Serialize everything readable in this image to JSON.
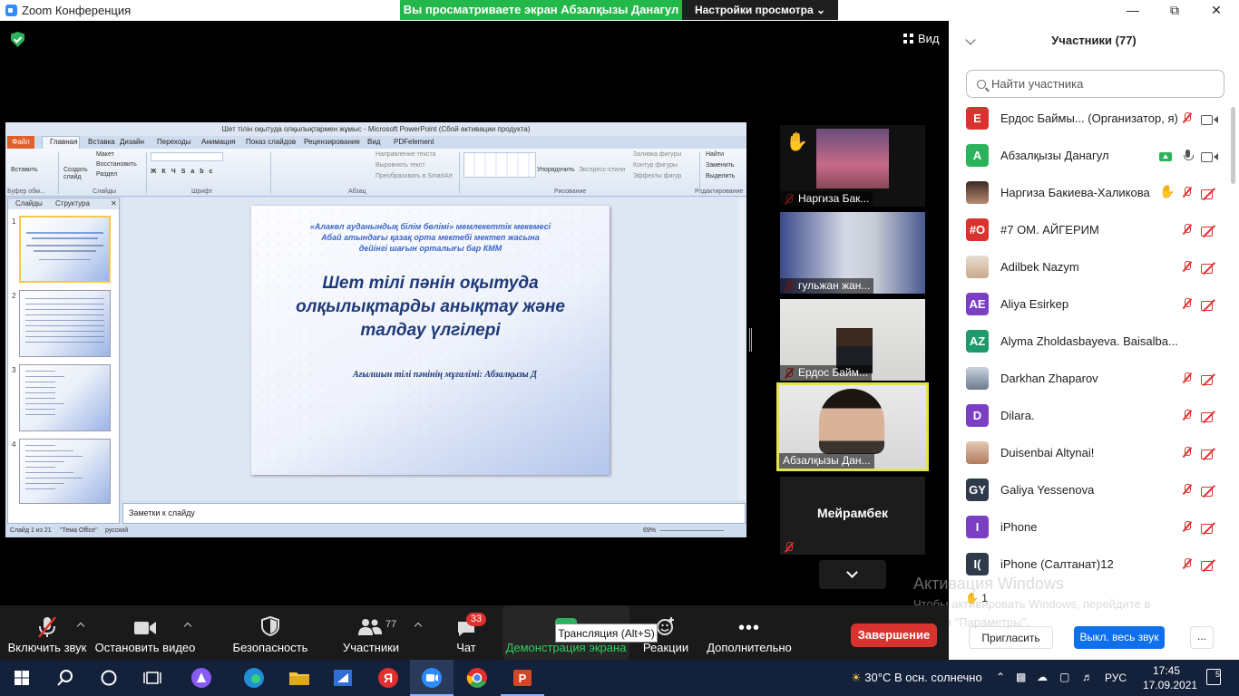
{
  "titlebar": {
    "app_title": "Zoom Конференция",
    "share_banner": "Вы просматриваете экран Абзалқызы Данагул",
    "view_options": "Настройки просмотра"
  },
  "meeting": {
    "view_label": "Вид"
  },
  "ppt": {
    "window_title": "Шет тілін оқытуда олқылықтармен жұмыс - Microsoft PowerPoint (Сбой активации продукта)",
    "file_tab": "Файл",
    "tabs": [
      "Главная",
      "Вставка",
      "Дизайн",
      "Переходы",
      "Анимация",
      "Показ слайдов",
      "Рецензирование",
      "Вид",
      "PDFelement"
    ],
    "ribbon": {
      "paste": "Вставить",
      "new_slide": "Создать слайд",
      "layout": "Макет",
      "reset": "Восстановить",
      "section": "Раздел",
      "text_direction": "Направление текста",
      "align_text": "Выровнять текст",
      "smartart": "Преобразовать в SmartArt",
      "arrange": "Упорядочить",
      "quick_styles": "Экспресс-стили",
      "shape_fill": "Заливка фигуры",
      "shape_outline": "Контур фигуры",
      "shape_effects": "Эффекты фигур",
      "find": "Найти",
      "replace": "Заменить",
      "select": "Выделить",
      "group_clipboard": "Буфер обм...",
      "group_slides": "Слайды",
      "group_font": "Шрифт",
      "group_paragraph": "Абзац",
      "group_drawing": "Рисование",
      "group_editing": "Редактирование"
    },
    "panel_tabs": [
      "Слайды",
      "Структура"
    ],
    "thumb_numbers": [
      "1",
      "2",
      "3",
      "4"
    ],
    "slide": {
      "org_line1": "«Алакөл ауданындық білім бөлімі» мемлекеттік мекемесі",
      "org_line2": "Абай атындағы қазақ орта мектебі мектеп жасына",
      "org_line3": "дейінгі шағын орталығы бар КММ",
      "title_line1": "Шет тілі пәнін оқытуда",
      "title_line2": "олқылықтарды анықтау және",
      "title_line3": "талдау үлгілері",
      "author": "Ағылшын тілі пәнінің мұғалімі: Абзалқызы Д"
    },
    "notes": "Заметки к слайду",
    "status": {
      "slide_count": "Слайд 1 из 21",
      "theme": "\"Тема Office\"",
      "language": "русский",
      "zoom": "69%"
    }
  },
  "gallery": [
    {
      "name": "Наргиза Бак...",
      "muted": true
    },
    {
      "name": "гульжан жан...",
      "muted": true
    },
    {
      "name": "Ердос Байм...",
      "muted": true
    },
    {
      "name": "Абзалқызы Дан...",
      "muted": false
    },
    {
      "name": "Мейрамбек",
      "muted": true
    }
  ],
  "participants": {
    "title": "Участники (77)",
    "search_placeholder": "Найти участника",
    "list": [
      {
        "initials": "E",
        "name": "Ердос Баймы... (Организатор, я)",
        "color": "#d9332f"
      },
      {
        "initials": "A",
        "name": "Абзалқызы Данагул",
        "color": "#2bb35b"
      },
      {
        "initials": "",
        "name": "Наргиза Бакиева-Халикова",
        "color": "#6b4a3a"
      },
      {
        "initials": "#O",
        "name": "#7 ОМ. АЙГЕРИМ",
        "color": "#d9332f"
      },
      {
        "initials": "",
        "name": "Adilbek Nazym",
        "color": "#c8b6a0"
      },
      {
        "initials": "AE",
        "name": "Aliya Esirkep",
        "color": "#7b3fc4"
      },
      {
        "initials": "AZ",
        "name": "Alyma Zholdasbayeva. Baisalba...",
        "color": "#1f9a6a"
      },
      {
        "initials": "",
        "name": "Darkhan Zhaparov",
        "color": "#7f8fa5"
      },
      {
        "initials": "D",
        "name": "Dilara.",
        "color": "#7b3fc4"
      },
      {
        "initials": "",
        "name": "Duisenbai Altynai!",
        "color": "#c8a08a"
      },
      {
        "initials": "GY",
        "name": "Galiya Yessenova",
        "color": "#2f3a4a"
      },
      {
        "initials": "I",
        "name": "iPhone",
        "color": "#7b3fc4"
      },
      {
        "initials": "I(",
        "name": "iPhone (Салтанат)12",
        "color": "#2f3a4a"
      }
    ],
    "raised_count": "1",
    "invite": "Пригласить",
    "mute_all": "Выкл. весь звук",
    "more": "..."
  },
  "activation": {
    "title": "Активация Windows",
    "line1": "Чтобы активировать Windows, перейдите в",
    "line2": "раздел \"Параметры\"."
  },
  "toolbar": {
    "unmute": "Включить звук",
    "start_video": "Остановить видео",
    "security": "Безопасность",
    "participants": "Участники",
    "participants_count": "77",
    "chat": "Чат",
    "chat_badge": "33",
    "share": "Демонстрация экрана",
    "reactions": "Реакции",
    "more": "Дополнительно",
    "end": "Завершение",
    "tooltip": "Трансляция (Alt+S)"
  },
  "taskbar": {
    "weather": "30°C  В осн. солнечно",
    "lang": "РУС",
    "time": "17:45",
    "date": "17.09.2021",
    "notifications": "5"
  }
}
